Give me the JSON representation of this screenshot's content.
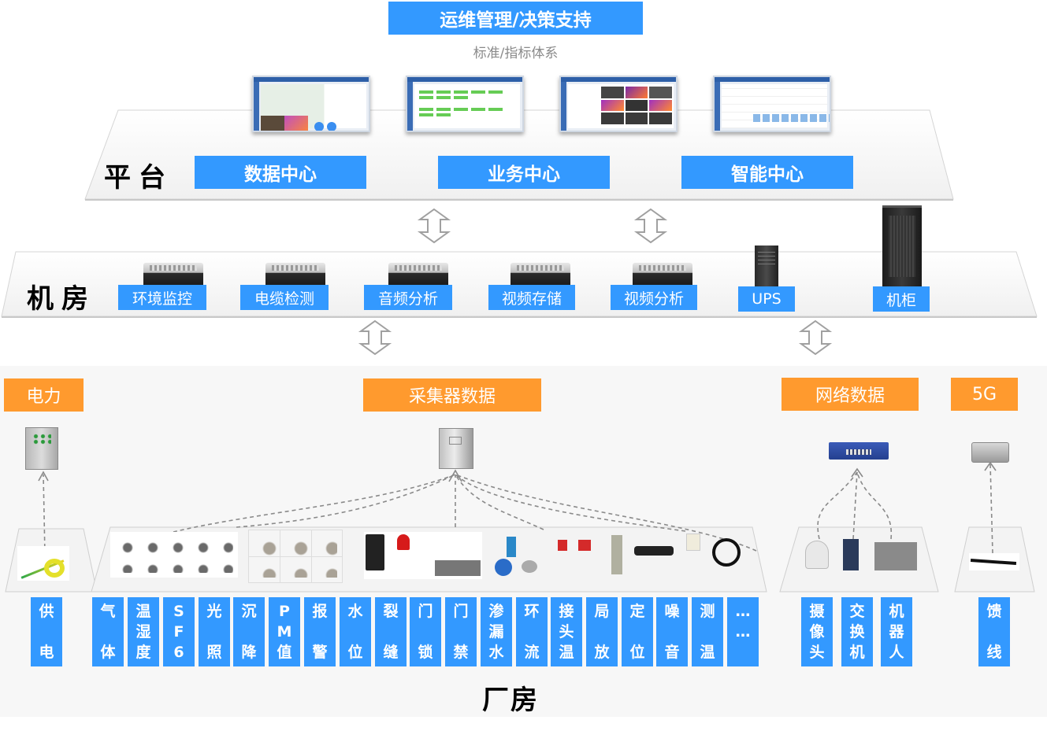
{
  "header": {
    "title": "运维管理/决策支持",
    "subtitle": "标准/指标体系"
  },
  "platform": {
    "label": "平台",
    "screens": [
      "data-center-screen",
      "business-center-screen",
      "smart-center-screen-video",
      "smart-center-screen-schedule"
    ],
    "centers": [
      "数据中心",
      "业务中心",
      "智能中心"
    ]
  },
  "server_room": {
    "label": "机房",
    "items": [
      "环境监控",
      "电缆检测",
      "音频分析",
      "视频存储",
      "视频分析",
      "UPS",
      "机柜"
    ]
  },
  "factory": {
    "label": "厂房",
    "groups": [
      {
        "title": "电力",
        "device": "power-distribution-box",
        "items": [
          [
            "供",
            "",
            "电"
          ]
        ]
      },
      {
        "title": "采集器数据",
        "device": "data-collector-cabinet",
        "items": [
          [
            "气",
            "",
            "体"
          ],
          [
            "温",
            "湿",
            "度"
          ],
          [
            "S",
            "F",
            "6"
          ],
          [
            "光",
            "",
            "照"
          ],
          [
            "沉",
            "",
            "降"
          ],
          [
            "P",
            "M",
            "值"
          ],
          [
            "报",
            "",
            "警"
          ],
          [
            "水",
            "",
            "位"
          ],
          [
            "裂",
            "",
            "缝"
          ],
          [
            "门",
            "",
            "锁"
          ],
          [
            "门",
            "",
            "禁"
          ],
          [
            "渗",
            "漏",
            "水"
          ],
          [
            "环",
            "",
            "流"
          ],
          [
            "接",
            "头",
            "温"
          ],
          [
            "局",
            "",
            "放"
          ],
          [
            "定",
            "",
            "位"
          ],
          [
            "噪",
            "",
            "音"
          ],
          [
            "测",
            "",
            "温"
          ],
          [
            "…",
            "…",
            ""
          ]
        ]
      },
      {
        "title": "网络数据",
        "device": "network-switch",
        "items": [
          [
            "摄",
            "像",
            "头"
          ],
          [
            "交",
            "换",
            "机"
          ],
          [
            "机",
            "器",
            "人"
          ]
        ]
      },
      {
        "title": "5G",
        "device": "5g-base-station",
        "items": [
          [
            "馈",
            "",
            "线"
          ]
        ]
      }
    ]
  },
  "colors": {
    "blue": "#3399ff",
    "orange": "#ff9a2e",
    "layer_bg": "#f7f7f7"
  }
}
